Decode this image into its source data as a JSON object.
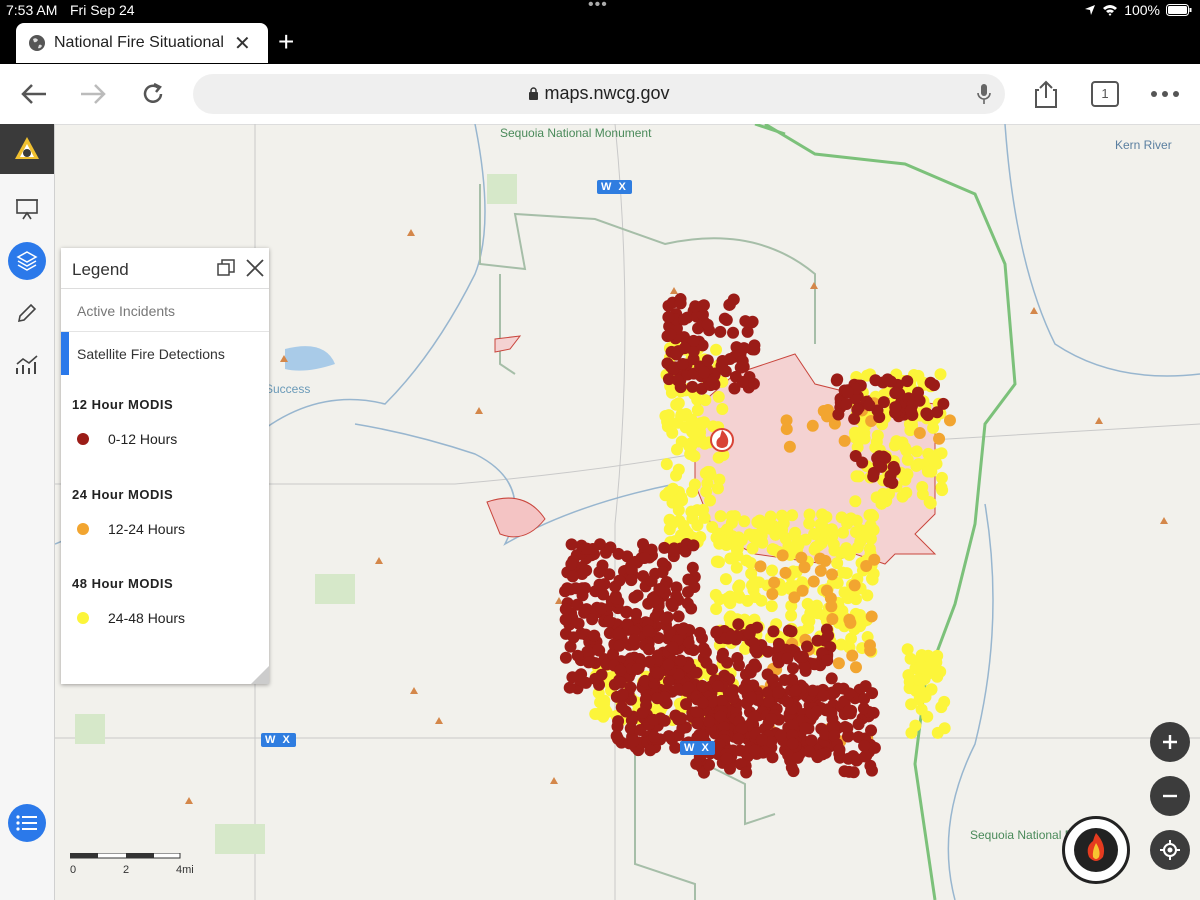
{
  "status_bar": {
    "time": "7:53 AM",
    "date": "Fri Sep 24",
    "battery": "100%"
  },
  "tab": {
    "title": "National Fire Situational /"
  },
  "toolbar": {
    "url": "maps.nwcg.gov",
    "tab_count": "1"
  },
  "map": {
    "labels": {
      "sequoia_monument": "Sequoia National Monument",
      "kern_river": "Kern River",
      "success": "Success",
      "sequoia_forest": "Sequoia National Forest"
    },
    "wx_badge": "W X",
    "scale": {
      "ticks": [
        "0",
        "2",
        "4mi"
      ]
    }
  },
  "legend": {
    "title": "Legend",
    "tabs": [
      "Active Incidents",
      "Satellite Fire Detections"
    ],
    "sections": [
      {
        "heading": "12 Hour MODIS",
        "item": "0-12 Hours",
        "color": "#9b1c17"
      },
      {
        "heading": "24 Hour MODIS",
        "item": "12-24 Hours",
        "color": "#f2a530"
      },
      {
        "heading": "48 Hour MODIS",
        "item": "24-48 Hours",
        "color": "#fcf53a"
      }
    ]
  },
  "colors": {
    "accent": "#2b79ea",
    "detection_12h": "#9b1c17",
    "detection_24h": "#f2a530",
    "detection_48h": "#fcf53a",
    "perimeter_fill": "#f4d2d2"
  }
}
